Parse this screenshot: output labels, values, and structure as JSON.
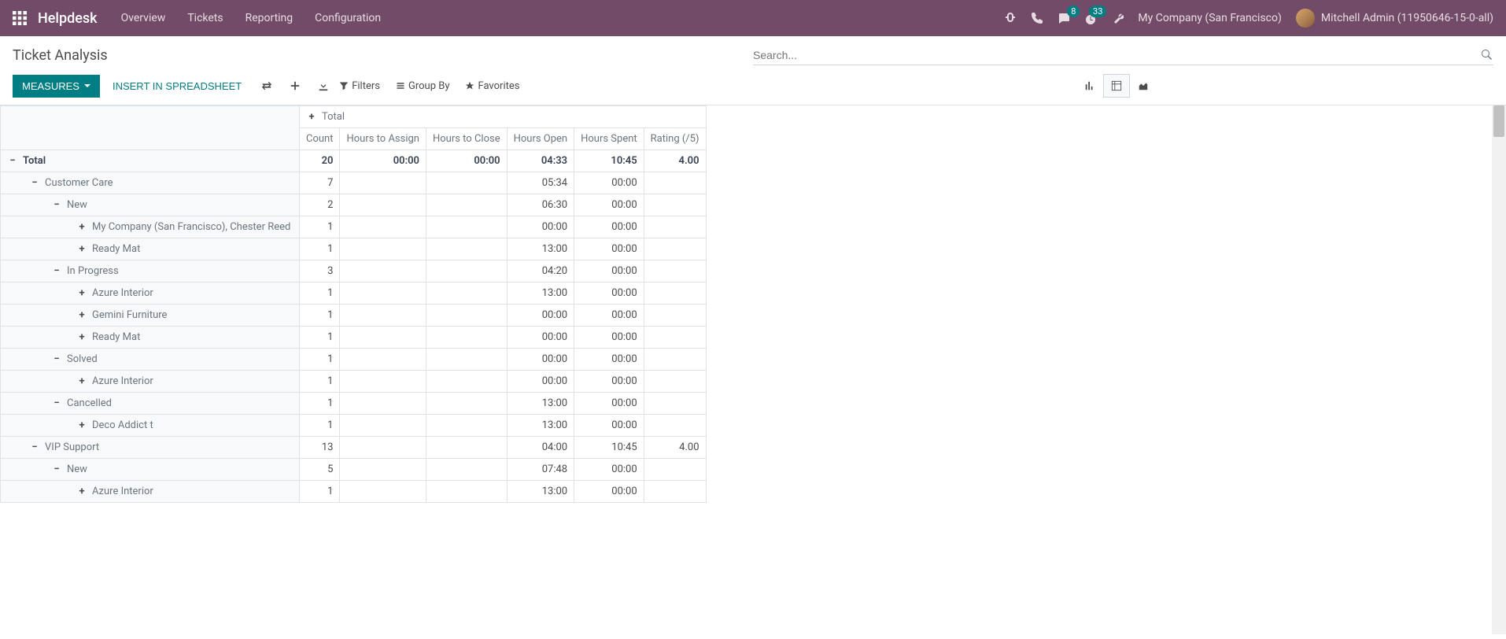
{
  "navbar": {
    "brand": "Helpdesk",
    "links": [
      "Overview",
      "Tickets",
      "Reporting",
      "Configuration"
    ],
    "messaging_badge": "8",
    "activity_badge": "33",
    "company": "My Company (San Francisco)",
    "user": "Mitchell Admin (11950646-15-0-all)"
  },
  "page": {
    "title": "Ticket Analysis"
  },
  "search": {
    "placeholder": "Search..."
  },
  "buttons": {
    "measures": "MEASURES",
    "insert": "INSERT IN SPREADSHEET",
    "filters": "Filters",
    "groupby": "Group By",
    "favorites": "Favorites"
  },
  "columns": {
    "total": "Total",
    "count": "Count",
    "hta": "Hours to Assign",
    "htc": "Hours to Close",
    "ho": "Hours Open",
    "hs": "Hours Spent",
    "rating": "Rating (/5)"
  },
  "rows": [
    {
      "level": 0,
      "expand": "minus",
      "label": "Total",
      "bold": true,
      "count": "20",
      "hta": "00:00",
      "htc": "00:00",
      "ho": "04:33",
      "hs": "10:45",
      "rating": "4.00"
    },
    {
      "level": 1,
      "expand": "minus",
      "label": "Customer Care",
      "count": "7",
      "hta": "",
      "htc": "",
      "ho": "05:34",
      "hs": "00:00",
      "rating": ""
    },
    {
      "level": 2,
      "expand": "minus",
      "label": "New",
      "count": "2",
      "hta": "",
      "htc": "",
      "ho": "06:30",
      "hs": "00:00",
      "rating": ""
    },
    {
      "level": 3,
      "expand": "plus",
      "label": "My Company (San Francisco), Chester Reed",
      "count": "1",
      "hta": "",
      "htc": "",
      "ho": "00:00",
      "hs": "00:00",
      "rating": ""
    },
    {
      "level": 3,
      "expand": "plus",
      "label": "Ready Mat",
      "count": "1",
      "hta": "",
      "htc": "",
      "ho": "13:00",
      "hs": "00:00",
      "rating": ""
    },
    {
      "level": 2,
      "expand": "minus",
      "label": "In Progress",
      "count": "3",
      "hta": "",
      "htc": "",
      "ho": "04:20",
      "hs": "00:00",
      "rating": ""
    },
    {
      "level": 3,
      "expand": "plus",
      "label": "Azure Interior",
      "count": "1",
      "hta": "",
      "htc": "",
      "ho": "13:00",
      "hs": "00:00",
      "rating": ""
    },
    {
      "level": 3,
      "expand": "plus",
      "label": "Gemini Furniture",
      "count": "1",
      "hta": "",
      "htc": "",
      "ho": "00:00",
      "hs": "00:00",
      "rating": ""
    },
    {
      "level": 3,
      "expand": "plus",
      "label": "Ready Mat",
      "count": "1",
      "hta": "",
      "htc": "",
      "ho": "00:00",
      "hs": "00:00",
      "rating": ""
    },
    {
      "level": 2,
      "expand": "minus",
      "label": "Solved",
      "count": "1",
      "hta": "",
      "htc": "",
      "ho": "00:00",
      "hs": "00:00",
      "rating": ""
    },
    {
      "level": 3,
      "expand": "plus",
      "label": "Azure Interior",
      "count": "1",
      "hta": "",
      "htc": "",
      "ho": "00:00",
      "hs": "00:00",
      "rating": ""
    },
    {
      "level": 2,
      "expand": "minus",
      "label": "Cancelled",
      "count": "1",
      "hta": "",
      "htc": "",
      "ho": "13:00",
      "hs": "00:00",
      "rating": ""
    },
    {
      "level": 3,
      "expand": "plus",
      "label": "Deco Addict t",
      "count": "1",
      "hta": "",
      "htc": "",
      "ho": "13:00",
      "hs": "00:00",
      "rating": ""
    },
    {
      "level": 1,
      "expand": "minus",
      "label": "VIP Support",
      "count": "13",
      "hta": "",
      "htc": "",
      "ho": "04:00",
      "hs": "10:45",
      "rating": "4.00"
    },
    {
      "level": 2,
      "expand": "minus",
      "label": "New",
      "count": "5",
      "hta": "",
      "htc": "",
      "ho": "07:48",
      "hs": "00:00",
      "rating": ""
    },
    {
      "level": 3,
      "expand": "plus",
      "label": "Azure Interior",
      "count": "1",
      "hta": "",
      "htc": "",
      "ho": "13:00",
      "hs": "00:00",
      "rating": ""
    }
  ]
}
